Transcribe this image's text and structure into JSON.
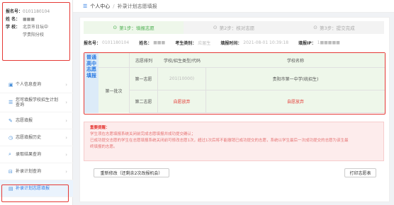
{
  "profile": {
    "exam_no_label": "报名号：",
    "exam_no_value": "0101180104",
    "name_label": "姓  名：",
    "name_value": "■■■",
    "school_label": "学  校：",
    "school_value_1": "北京市日坛中",
    "school_value_2": "学贵阳分校"
  },
  "menu": {
    "items": [
      {
        "label": "个人信息查询",
        "icon": "user-card-icon"
      },
      {
        "label": "您可填报学校招生计划查询",
        "icon": "list-icon"
      },
      {
        "label": "志愿填报",
        "icon": "edit-icon"
      },
      {
        "label": "志愿填报历史",
        "icon": "history-icon"
      },
      {
        "label": "录取结果查询",
        "icon": "search-icon"
      },
      {
        "label": "补录计划查询",
        "icon": "plan-icon"
      },
      {
        "label": "补录计划志愿填报",
        "icon": "form-icon"
      }
    ]
  },
  "breadcrumb": {
    "home": "个人中心",
    "sep": "/",
    "current": "补录计划志愿填报"
  },
  "steps": [
    {
      "label": "第1步：填报志愿"
    },
    {
      "label": "第2步：核对志愿"
    },
    {
      "label": "第3步：提交完成"
    }
  ],
  "info": {
    "exam_no_label": "报名号：",
    "exam_no_value": "0101180104",
    "name_label": "姓名：",
    "name_value": "■■■",
    "type_label": "考生类别：",
    "type_value": "应届生",
    "time_label": "填报时间：",
    "time_value": "2021-08-01 10:39:18",
    "ip_label": "填报IP：",
    "ip_value": "1■■■■■"
  },
  "table": {
    "vertical_label": "普通高中志愿填报",
    "batch": "第一批次",
    "headers": {
      "order": "志愿排列",
      "code": "学校/招生类型/代码",
      "name": "学校名称"
    },
    "rows": [
      {
        "order": "第一志愿",
        "code": "201(10000)",
        "name": "贵阳市第一中学(统招生)"
      },
      {
        "order": "第二志愿",
        "code": "自愿放弃",
        "name": "自愿放弃"
      }
    ]
  },
  "notice": {
    "title": "重要提醒：",
    "line1": "学生须在志愿填报系统关闭前完成志愿填报并成功提交确认；",
    "line2": "已成功提交志愿的学生在志愿填报系统关闭前可修改志愿1次，超过1次后将不能撤销已成功提交的志愿，系统以学生最后一次成功提交的志愿为该生最",
    "line3": "终填报的志愿。"
  },
  "buttons": {
    "modify": "重新修改（还剩余2次改报机会）",
    "print": "打印志愿表"
  }
}
